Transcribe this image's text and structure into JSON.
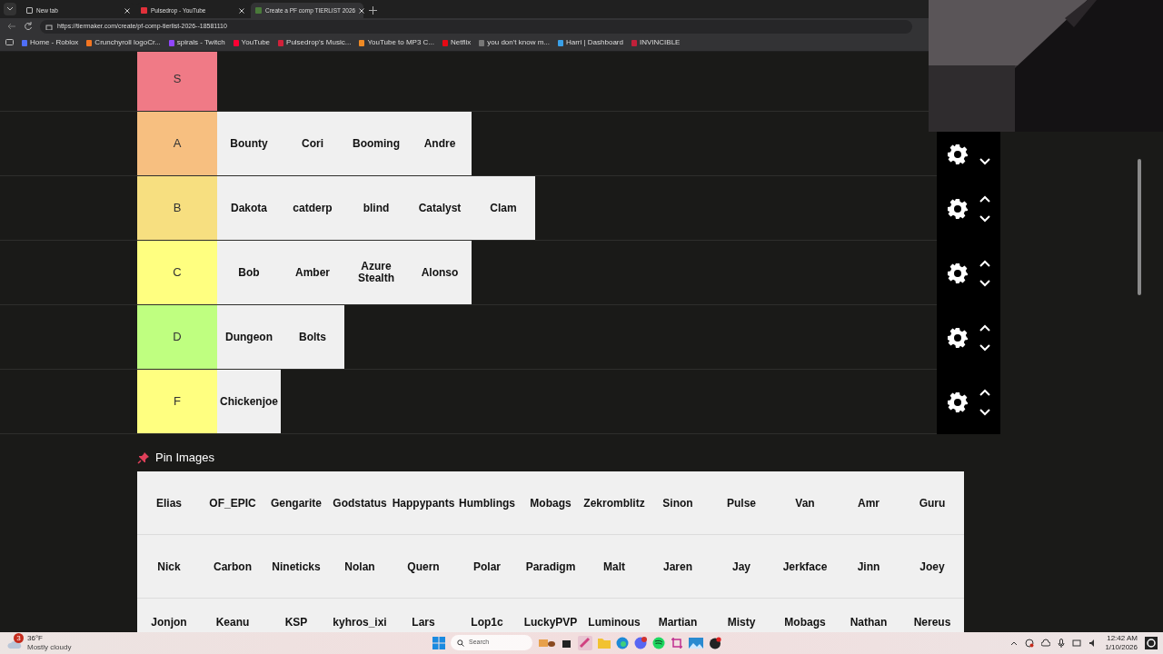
{
  "browser": {
    "tabs": [
      {
        "title": "New tab",
        "selected": false
      },
      {
        "title": "Pulsedrop - YouTube",
        "selected": false
      },
      {
        "title": "Create a PF comp TIERLIST 2026",
        "selected": true
      }
    ],
    "url": "https://tiermaker.com/create/pf-comp-tierlist-2026--18581110",
    "bookmarks": [
      {
        "label": "Home - Roblox",
        "color": "#4f6ef7"
      },
      {
        "label": "Crunchyroll logoCr...",
        "color": "#f47521"
      },
      {
        "label": "spirals - Twitch",
        "color": "#9146ff"
      },
      {
        "label": "YouTube",
        "color": "#ff0033"
      },
      {
        "label": "Pulsedrop's Music...",
        "color": "#d1213a"
      },
      {
        "label": "YouTube to MP3 C...",
        "color": "#f08a24"
      },
      {
        "label": "Netflix",
        "color": "#e50914"
      },
      {
        "label": "you don't know m...",
        "color": "#777777"
      },
      {
        "label": "Harri | Dashboard",
        "color": "#3aa0e8"
      },
      {
        "label": "INVINCIBLE",
        "color": "#c0203a"
      }
    ]
  },
  "tiers": [
    {
      "label": "S",
      "color": "#f07a86",
      "controls_shown": false
    },
    {
      "label": "A",
      "color": "#f7bf80",
      "controls_shown": true,
      "items": [
        "Bounty",
        "Cori",
        "Booming",
        "Andre"
      ]
    },
    {
      "label": "B",
      "color": "#f7df80",
      "controls_shown": true,
      "items": [
        "Dakota",
        "catderp",
        "blind",
        "Catalyst",
        "Clam"
      ]
    },
    {
      "label": "C",
      "color": "#ffff80",
      "controls_shown": true,
      "items": [
        "Bob",
        "Amber",
        "Azure Stealth",
        "Alonso"
      ]
    },
    {
      "label": "D",
      "color": "#bfff80",
      "controls_shown": true,
      "items": [
        "Dungeon",
        "Bolts"
      ]
    },
    {
      "label": "F",
      "color": "#ffff80",
      "controls_shown": true,
      "items": [
        "Chickenjoe"
      ]
    }
  ],
  "pool": {
    "title": "Pin Images",
    "rows": [
      [
        "Elias",
        "OF_EPIC",
        "Gengarite",
        "Godstatus",
        "Happypants",
        "Humblings",
        "Mobags",
        "Zekromblitz",
        "Sinon",
        "Pulse",
        "Van",
        "Amr",
        "Guru"
      ],
      [
        "Nick",
        "Carbon",
        "Nineticks",
        "Nolan",
        "Quern",
        "Polar",
        "Paradigm",
        "Malt",
        "Jaren",
        "Jay",
        "Jerkface",
        "Jinn",
        "Joey"
      ],
      [
        "Jonjon",
        "Keanu",
        "KSP",
        "kyhros_ixi",
        "Lars",
        "Lop1c",
        "LuckyPVP",
        "Luminous",
        "Martian",
        "Misty",
        "Mobags",
        "Nathan",
        "Nereus"
      ]
    ]
  },
  "taskbar": {
    "weather": {
      "badge": "3",
      "temperature": "36°F",
      "condition": "Mostly cloudy"
    },
    "search_placeholder": "Search",
    "time": "12:42 AM",
    "date": "1/10/2026"
  }
}
